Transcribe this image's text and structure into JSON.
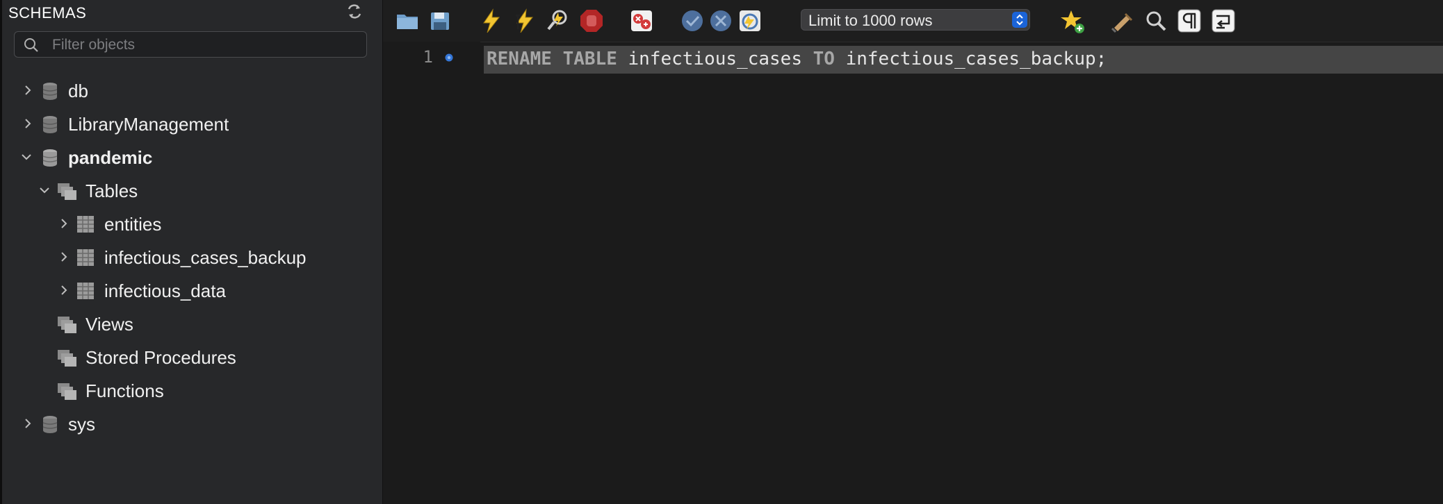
{
  "sidebar": {
    "title": "SCHEMAS",
    "filter_placeholder": "Filter objects",
    "tree": [
      {
        "label": "db",
        "kind": "schema",
        "expanded": false
      },
      {
        "label": "LibraryManagement",
        "kind": "schema",
        "expanded": false
      },
      {
        "label": "pandemic",
        "kind": "schema",
        "expanded": true,
        "active": true
      },
      {
        "label": "Tables",
        "kind": "folder",
        "expanded": true
      },
      {
        "label": "entities",
        "kind": "table",
        "expanded": false
      },
      {
        "label": "infectious_cases_backup",
        "kind": "table",
        "expanded": false
      },
      {
        "label": "infectious_data",
        "kind": "table",
        "expanded": false
      },
      {
        "label": "Views",
        "kind": "folder"
      },
      {
        "label": "Stored Procedures",
        "kind": "folder"
      },
      {
        "label": "Functions",
        "kind": "folder"
      },
      {
        "label": "sys",
        "kind": "schema",
        "expanded": false
      }
    ]
  },
  "toolbar": {
    "limit_label": "Limit to 1000 rows",
    "icons": [
      "open-file-icon",
      "save-icon",
      "execute-icon",
      "execute-current-icon",
      "explain-icon",
      "stop-icon",
      "toggle-error-stop-icon",
      "commit-icon",
      "rollback-icon",
      "autocommit-icon",
      "add-snippet-icon",
      "beautify-icon",
      "find-icon",
      "invisible-chars-icon",
      "wrap-lines-icon"
    ]
  },
  "editor": {
    "line_number": "1",
    "code": {
      "kw1": "RENAME",
      "kw2": "TABLE",
      "ident1": "infectious_cases",
      "kw3": "TO",
      "ident2": "infectious_cases_backup;"
    }
  },
  "colors": {
    "sidebar_bg": "#27282a",
    "editor_bg": "#1b1b1b",
    "current_line": "#454545",
    "accent_blue": "#1b64d8"
  }
}
